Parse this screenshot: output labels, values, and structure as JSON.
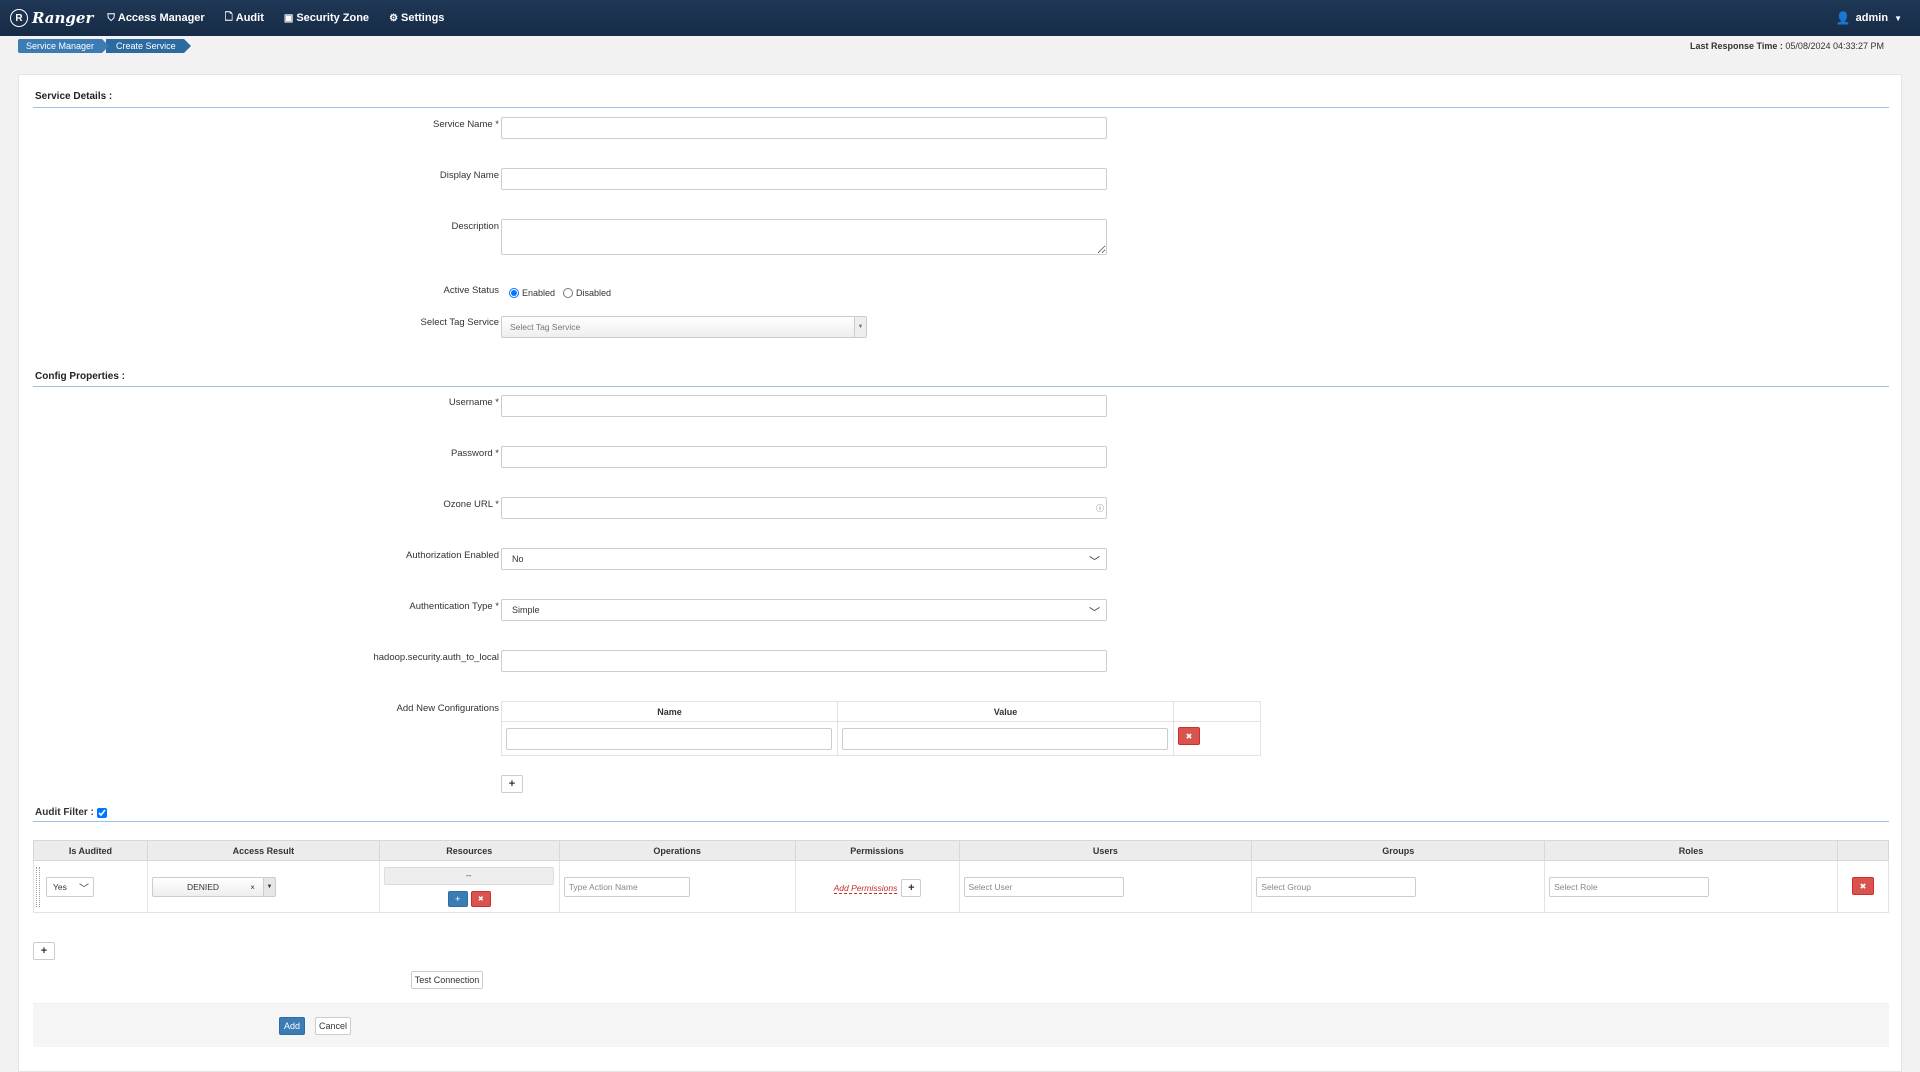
{
  "nav": {
    "brand": "Ranger",
    "items": [
      {
        "label": "Access Manager",
        "icon": "shield-icon"
      },
      {
        "label": "Audit",
        "icon": "file-icon"
      },
      {
        "label": "Security Zone",
        "icon": "zone-icon"
      },
      {
        "label": "Settings",
        "icon": "gear-icon"
      }
    ],
    "user": "admin"
  },
  "breadcrumb": [
    "Service Manager",
    "Create Service"
  ],
  "last_response": {
    "label": "Last Response Time :",
    "value": "05/08/2024 04:33:27 PM"
  },
  "service_details": {
    "title": "Service Details :",
    "service_name_label": "Service Name *",
    "display_name_label": "Display Name",
    "description_label": "Description",
    "active_status_label": "Active Status",
    "enabled_label": "Enabled",
    "disabled_label": "Disabled",
    "tag_service_label": "Select Tag Service",
    "tag_service_placeholder": "Select Tag Service"
  },
  "config": {
    "title": "Config Properties :",
    "username_label": "Username *",
    "password_label": "Password *",
    "ozone_url_label": "Ozone URL *",
    "auth_enabled_label": "Authorization Enabled",
    "auth_enabled_value": "No",
    "auth_type_label": "Authentication Type *",
    "auth_type_value": "Simple",
    "auth_to_local_label": "hadoop.security.auth_to_local",
    "add_new_label": "Add New Configurations",
    "name_header": "Name",
    "value_header": "Value"
  },
  "audit_filter": {
    "title": "Audit Filter :",
    "headers": [
      "Is Audited",
      "Access Result",
      "Resources",
      "Operations",
      "Permissions",
      "Users",
      "Groups",
      "Roles"
    ],
    "is_audited": "Yes",
    "access_result": "DENIED",
    "resources": "--",
    "operations_placeholder": "Type Action Name",
    "add_permissions": "Add Permissions",
    "users_placeholder": "Select User",
    "groups_placeholder": "Select Group",
    "roles_placeholder": "Select Role"
  },
  "buttons": {
    "test_connection": "Test Connection",
    "add": "Add",
    "cancel": "Cancel"
  },
  "colors": {
    "navbar": "#1f3857",
    "primary": "#3b7cb5",
    "danger": "#d9534f"
  }
}
